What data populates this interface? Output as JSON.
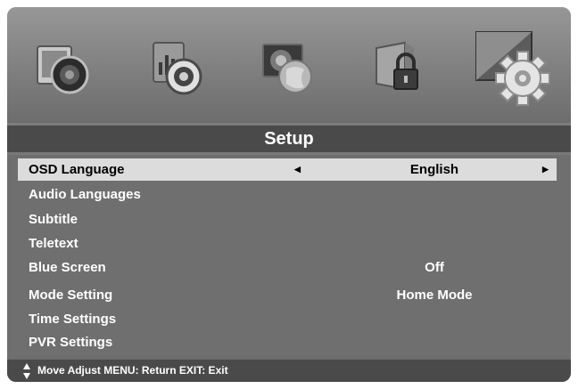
{
  "tabs": [
    {
      "icon": "picture-icon",
      "active": false
    },
    {
      "icon": "sound-icon",
      "active": false
    },
    {
      "icon": "channel-icon",
      "active": false
    },
    {
      "icon": "lock-icon",
      "active": false
    },
    {
      "icon": "setup-gear-icon",
      "active": true
    }
  ],
  "menu": {
    "title": "Setup",
    "items": [
      {
        "label": "OSD Language",
        "value": "English",
        "selected": true
      },
      {
        "label": "Audio Languages",
        "value": ""
      },
      {
        "label": "Subtitle",
        "value": ""
      },
      {
        "label": "Teletext",
        "value": ""
      },
      {
        "label": "Blue Screen",
        "value": "Off"
      },
      {
        "label": "Mode Setting",
        "value": "Home Mode"
      },
      {
        "label": "Time Settings",
        "value": ""
      },
      {
        "label": "PVR Settings",
        "value": ""
      }
    ]
  },
  "footer": {
    "hint": "Move Adjust MENU: Return EXIT: Exit"
  },
  "colors": {
    "title_bar": "#4a4a4a",
    "selected_row": "#dcdcdc",
    "menu_bg": "#6f6f6f"
  }
}
